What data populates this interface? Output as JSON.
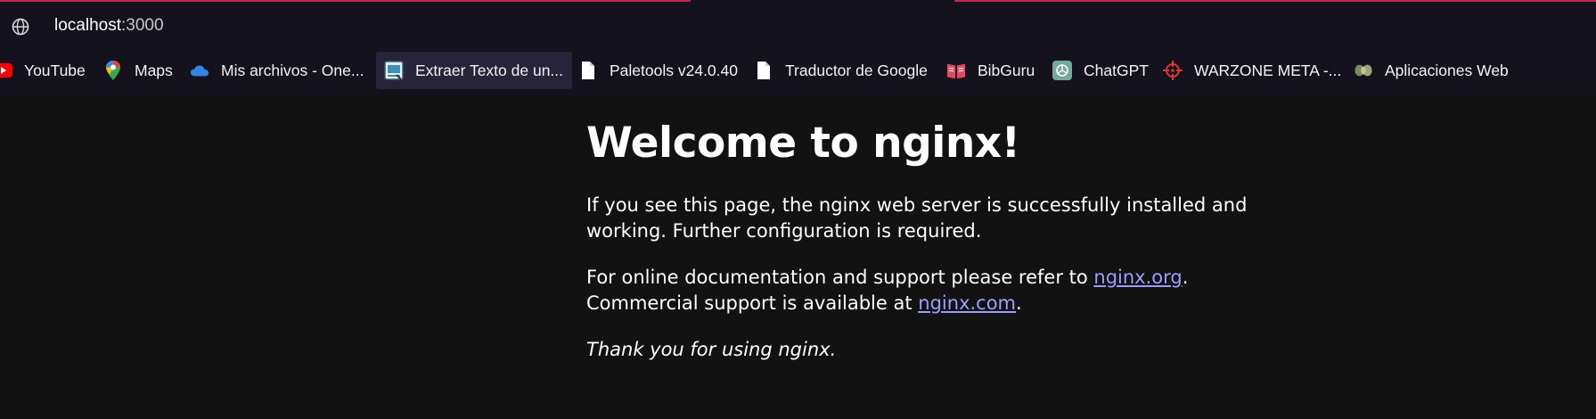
{
  "browser": {
    "url_host": "localhost",
    "url_port": ":3000",
    "accent_color": "#c8244f",
    "bookmarks": [
      {
        "label": "YouTube",
        "icon": "youtube-icon"
      },
      {
        "label": "Maps",
        "icon": "google-maps-icon"
      },
      {
        "label": "Mis archivos - One...",
        "icon": "onedrive-icon"
      },
      {
        "label": "Extraer Texto de un...",
        "icon": "text-extractor-icon"
      },
      {
        "label": "Paletools v24.0.40",
        "icon": "document-icon"
      },
      {
        "label": "Traductor de Google",
        "icon": "document-icon"
      },
      {
        "label": "BibGuru",
        "icon": "bibguru-icon"
      },
      {
        "label": "ChatGPT",
        "icon": "chatgpt-icon"
      },
      {
        "label": "WARZONE META -...",
        "icon": "crosshair-icon"
      },
      {
        "label": "Aplicaciones Web",
        "icon": "apps-icon"
      }
    ]
  },
  "page": {
    "heading": "Welcome to nginx!",
    "para1": "If you see this page, the nginx web server is successfully installed and working. Further configuration is required.",
    "para2_prefix": "For online documentation and support please refer to ",
    "link_org": "nginx.org",
    "para2_mid": ".",
    "para2_line2": "Commercial support is available at ",
    "link_com": "nginx.com",
    "para2_end": ".",
    "thanks": "Thank you for using nginx.",
    "link_color": "#9d9dff"
  }
}
